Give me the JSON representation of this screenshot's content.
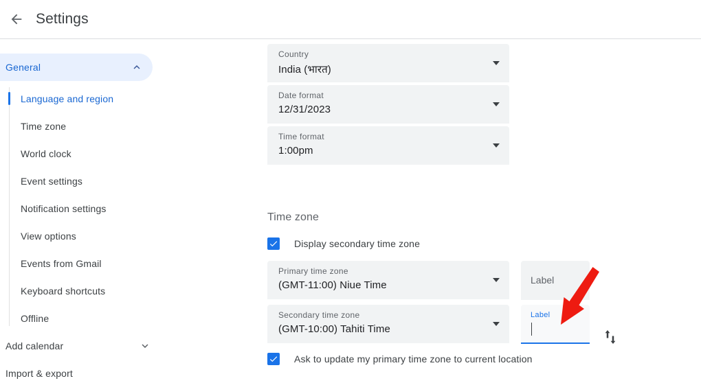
{
  "header": {
    "back_icon": "arrow-back-icon",
    "title": "Settings"
  },
  "sidebar": {
    "group": {
      "label": "General",
      "expanded": true,
      "chevron_icon": "chevron-up-icon"
    },
    "items": [
      {
        "label": "Language and region",
        "active": true
      },
      {
        "label": "Time zone",
        "active": false
      },
      {
        "label": "World clock",
        "active": false
      },
      {
        "label": "Event settings",
        "active": false
      },
      {
        "label": "Notification settings",
        "active": false
      },
      {
        "label": "View options",
        "active": false
      },
      {
        "label": "Events from Gmail",
        "active": false
      },
      {
        "label": "Keyboard shortcuts",
        "active": false
      },
      {
        "label": "Offline",
        "active": false
      }
    ],
    "bottom_items": [
      {
        "label": "Add calendar",
        "chevron_icon": "chevron-down-icon",
        "has_chevron": true
      },
      {
        "label": "Import & export",
        "has_chevron": false
      }
    ]
  },
  "main": {
    "language_region": {
      "country": {
        "label": "Country",
        "value": "India (भारत)",
        "caret_icon": "caret-down-icon"
      },
      "date_format": {
        "label": "Date format",
        "value": "12/31/2023",
        "caret_icon": "caret-down-icon"
      },
      "time_format": {
        "label": "Time format",
        "value": "1:00pm",
        "caret_icon": "caret-down-icon"
      }
    },
    "timezone": {
      "section_title": "Time zone",
      "display_secondary": {
        "label": "Display secondary time zone",
        "checked": true,
        "check_icon": "checkmark-icon"
      },
      "primary": {
        "label": "Primary time zone",
        "value": "(GMT-11:00) Niue Time",
        "caret_icon": "caret-down-icon"
      },
      "secondary": {
        "label": "Secondary time zone",
        "value": "(GMT-10:00) Tahiti Time",
        "caret_icon": "caret-down-icon"
      },
      "primary_label_field": {
        "placeholder": "Label",
        "value": "",
        "focused": false
      },
      "secondary_label_field": {
        "placeholder": "Label",
        "value": "",
        "focused": true
      },
      "swap_icon": "swap-vertical-icon",
      "ask_update": {
        "label": "Ask to update my primary time zone to current location",
        "checked": true,
        "check_icon": "checkmark-icon"
      }
    }
  },
  "annotation": {
    "arrow_icon": "red-pointer-arrow",
    "color": "#ee1b11"
  },
  "colors": {
    "accent": "#1a73e8",
    "accent_text": "#1967d2",
    "accent_bg": "#e8f0fe",
    "field_bg": "#f1f3f4",
    "text_primary": "#202124",
    "text_secondary": "#5f6368",
    "divider": "#dadce0"
  }
}
